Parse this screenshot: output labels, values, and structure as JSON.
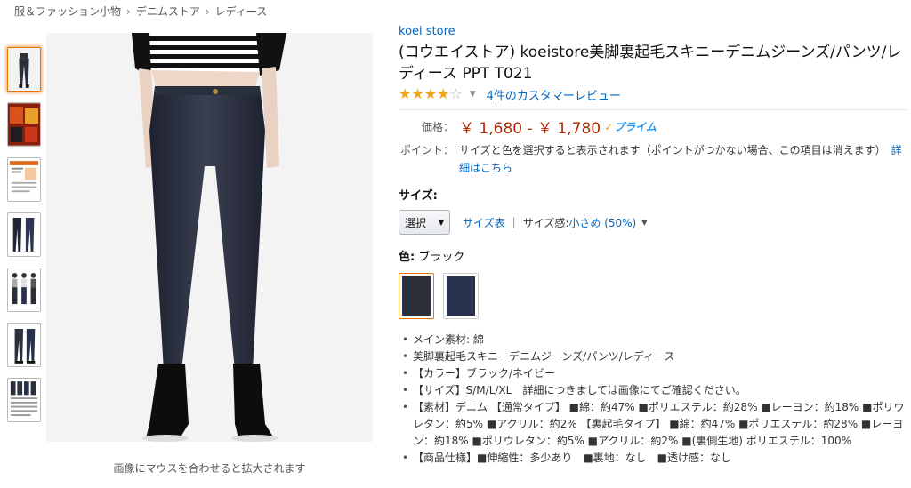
{
  "breadcrumb": [
    "服＆ファッション小物",
    "デニムストア",
    "レディース"
  ],
  "product": {
    "brand": "koei store",
    "title": "(コウエイストア) koeistore美脚裏起毛スキニーデニムジーンズ/パンツ/レディース PPT T021",
    "rating_stars": 4,
    "rating_max": 5,
    "review_text": "4件のカスタマーレビュー",
    "price_label": "価格：",
    "price": "￥ 1,680 - ￥ 1,780",
    "prime_label": "プライム",
    "point_label": "ポイント：",
    "point_text": "サイズと色を選択すると表示されます（ポイントがつかない場合、この項目は消えます）",
    "point_link": "詳細はこちら"
  },
  "size": {
    "label": "サイズ:",
    "select_value": "選択",
    "chart_link": "サイズ表",
    "fit_label": "サイズ感:",
    "fit_value": "小さめ (50%)"
  },
  "color": {
    "label": "色:",
    "value": "ブラック",
    "swatches": [
      {
        "name": "ブラック",
        "color": "#2a2f3a"
      },
      {
        "name": "ネイビー",
        "color": "#27324f"
      }
    ]
  },
  "bullets": [
    "メイン素材: 綿",
    "美脚裏起毛スキニーデニムジーンズ/パンツ/レディース",
    "【カラー】ブラック/ネイビー",
    "【サイズ】S/M/L/XL　詳細につきましては画像にてご確認ください。",
    "【素材】デニム 【通常タイプ】 ■綿：約47% ■ポリエステル：約28% ■レーヨン：約18% ■ポリウレタン：約5% ■アクリル：約2% 【裏起毛タイプ】 ■綿：約47% ■ポリエステル：約28% ■レーヨン：約18% ■ポリウレタン：約5% ■アクリル：約2% ■(裏側生地) ポリエステル：100%",
    "【商品仕様】■伸縮性：多少あり　■裏地：なし　■透け感：なし"
  ],
  "image_caption": "画像にマウスを合わせると拡大されます",
  "colors": {
    "link": "#0066c0",
    "price": "#b12704",
    "star": "#f0a41b",
    "selected_border": "#e77600"
  }
}
